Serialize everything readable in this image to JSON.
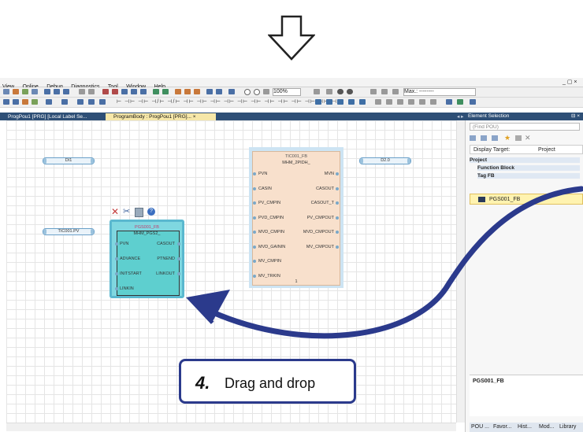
{
  "menu": [
    "View",
    "Online",
    "Debug",
    "Diagnostics",
    "Tool",
    "Window",
    "Help"
  ],
  "window_controls": "_ ▢ ×",
  "toolbar": {
    "zoom": "100%",
    "max_field": "Max.: --------"
  },
  "tabs": [
    {
      "label": "ProgPou1 [PRG] [Local Label Se..."
    },
    {
      "label": "ProgramBody : ProgPou1 [PRG]... ×"
    }
  ],
  "canvas": {
    "variables": [
      {
        "label": "DI1"
      },
      {
        "label": "D2.0"
      },
      {
        "label": "TIC001.PV"
      }
    ],
    "fb_tic": {
      "instance": "TIC001_FB",
      "type": "MHM_2PIDH_",
      "footer": "1",
      "inputs": [
        "PVN",
        "CASIN",
        "PV_CMPIN",
        "PVD_CMPIN",
        "MVD_CMPIN",
        "MVD_GAININ",
        "MV_CMPIN",
        "MV_TRKIN"
      ],
      "outputs": [
        "MVN",
        "CASOUT",
        "CASOUT_T",
        "PV_CMPOUT",
        "MVD_CMPOUT",
        "MV_CMPOUT"
      ]
    },
    "fb_pgs": {
      "instance": "PGS001_FB",
      "type": "MHM_PGS2_",
      "inputs": [
        "PVN",
        "ADVANCE",
        "INITSTART",
        "LINKIN"
      ],
      "outputs": [
        "CASOUT",
        "PTNEND",
        "LINKOUT"
      ]
    }
  },
  "panel": {
    "title": "Element Selection",
    "pin": "⊟ ×",
    "search_placeholder": "(Find POU)",
    "display_target_label": "Display Target:",
    "display_target_value": "Project",
    "tree": {
      "project": "Project",
      "function_block": "Function Block",
      "tag_fb": "Tag FB",
      "selected": "PGS001_FB"
    },
    "footer_label": "PGS001_FB",
    "bottom_tabs": [
      "POU ...",
      "Favor...",
      "Hist...",
      "Mod...",
      "Library"
    ]
  },
  "callout": {
    "step": "4.",
    "text": "Drag and drop"
  },
  "colors": {
    "accent_blue": "#2e4f76",
    "fb_tic_fill": "#f8e0cc",
    "fb_pgs_fill": "#5ecfcf",
    "arrow": "#2b3a8c",
    "highlight": "#fff3b0"
  }
}
